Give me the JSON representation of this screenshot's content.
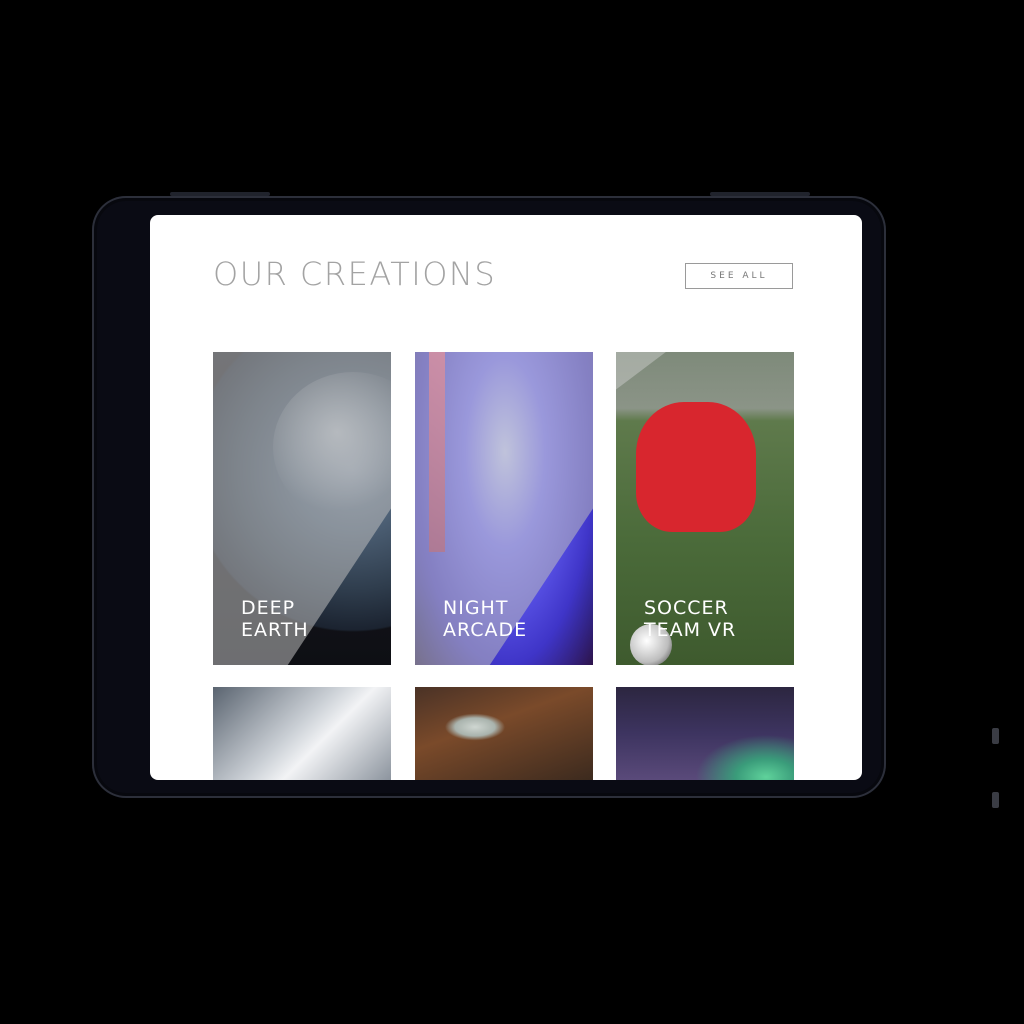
{
  "page": {
    "title": "OUR CREATIONS",
    "see_all_label": "SEE ALL"
  },
  "cards": [
    {
      "line1": "DEEP",
      "line2": "EARTH"
    },
    {
      "line1": "NIGHT",
      "line2": "ARCADE"
    },
    {
      "line1": "SOCCER",
      "line2": "TEAM VR"
    },
    {
      "line1": "",
      "line2": ""
    },
    {
      "line1": "",
      "line2": ""
    },
    {
      "line1": "",
      "line2": ""
    }
  ],
  "colors": {
    "title": "#a3a3a3",
    "tablet_bezel": "#0a0b14",
    "screen": "#ffffff",
    "button_border": "#9a9a9a"
  }
}
